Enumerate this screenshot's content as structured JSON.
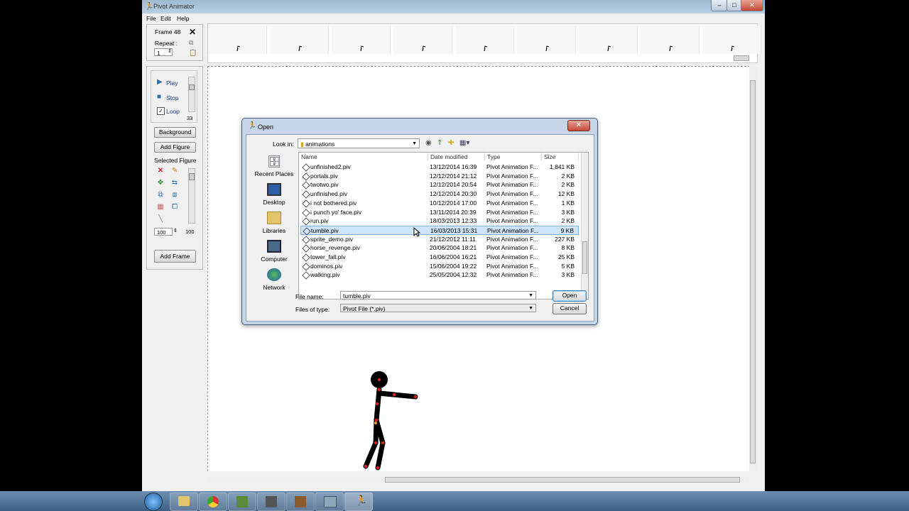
{
  "window": {
    "title": "Pivot Animator",
    "menu": [
      "File",
      "Edit",
      "Help"
    ]
  },
  "frame_panel": {
    "frame_label": "Frame 48",
    "repeat_label": "Repeat :",
    "repeat_value": "1"
  },
  "playback_panel": {
    "play_label": "Play",
    "stop_label": "Stop",
    "loop_label": "Loop",
    "speed_value": "33",
    "background_label": "Background",
    "add_figure_label": "Add Figure",
    "selected_figure_label": "Selected Figure",
    "scale_value": "100",
    "scale_max": "100",
    "add_frame_label": "Add Frame"
  },
  "dialog": {
    "title": "Open",
    "look_in_label": "Look in:",
    "look_in_value": "animations",
    "places": [
      "Recent Places",
      "Desktop",
      "Libraries",
      "Computer",
      "Network"
    ],
    "columns": [
      "Name",
      "Date modified",
      "Type",
      "Size"
    ],
    "files": [
      {
        "name": "unfinished2.piv",
        "date": "13/12/2014 16:39",
        "type": "Pivot Animation F...",
        "size": "1,841 KB"
      },
      {
        "name": "portals.piv",
        "date": "12/12/2014 21:12",
        "type": "Pivot Animation F...",
        "size": "2 KB"
      },
      {
        "name": "twotwo.piv",
        "date": "12/12/2014 20:54",
        "type": "Pivot Animation F...",
        "size": "2 KB"
      },
      {
        "name": "unfinished.piv",
        "date": "12/12/2014 20:30",
        "type": "Pivot Animation F...",
        "size": "12 KB"
      },
      {
        "name": "i not bothered.piv",
        "date": "10/12/2014 17:00",
        "type": "Pivot Animation F...",
        "size": "1 KB"
      },
      {
        "name": "i punch yo' face.piv",
        "date": "13/11/2014 20:39",
        "type": "Pivot Animation F...",
        "size": "3 KB"
      },
      {
        "name": "run.piv",
        "date": "18/03/2013 12:33",
        "type": "Pivot Animation F...",
        "size": "2 KB"
      },
      {
        "name": "tumble.piv",
        "date": "16/03/2013 15:31",
        "type": "Pivot Animation F...",
        "size": "9 KB"
      },
      {
        "name": "sprite_demo.piv",
        "date": "21/12/2012 11:11",
        "type": "Pivot Animation F...",
        "size": "227 KB"
      },
      {
        "name": "horse_revenge.piv",
        "date": "20/06/2004 18:21",
        "type": "Pivot Animation F...",
        "size": "8 KB"
      },
      {
        "name": "tower_fall.piv",
        "date": "16/06/2004 16:21",
        "type": "Pivot Animation F...",
        "size": "25 KB"
      },
      {
        "name": "dominos.piv",
        "date": "15/06/2004 19:22",
        "type": "Pivot Animation F...",
        "size": "5 KB"
      },
      {
        "name": "walking.piv",
        "date": "25/05/2004 12:32",
        "type": "Pivot Animation F...",
        "size": "3 KB"
      }
    ],
    "selected_file": "tumble.piv",
    "file_name_label": "File name:",
    "file_name_value": "tumble.piv",
    "files_of_type_label": "Files of type:",
    "files_of_type_value": "Pivot File (*.piv)",
    "open_label": "Open",
    "cancel_label": "Cancel"
  },
  "colors": {
    "figure": "#000000",
    "joint": "#e02020",
    "selection": "#cde4fb"
  }
}
